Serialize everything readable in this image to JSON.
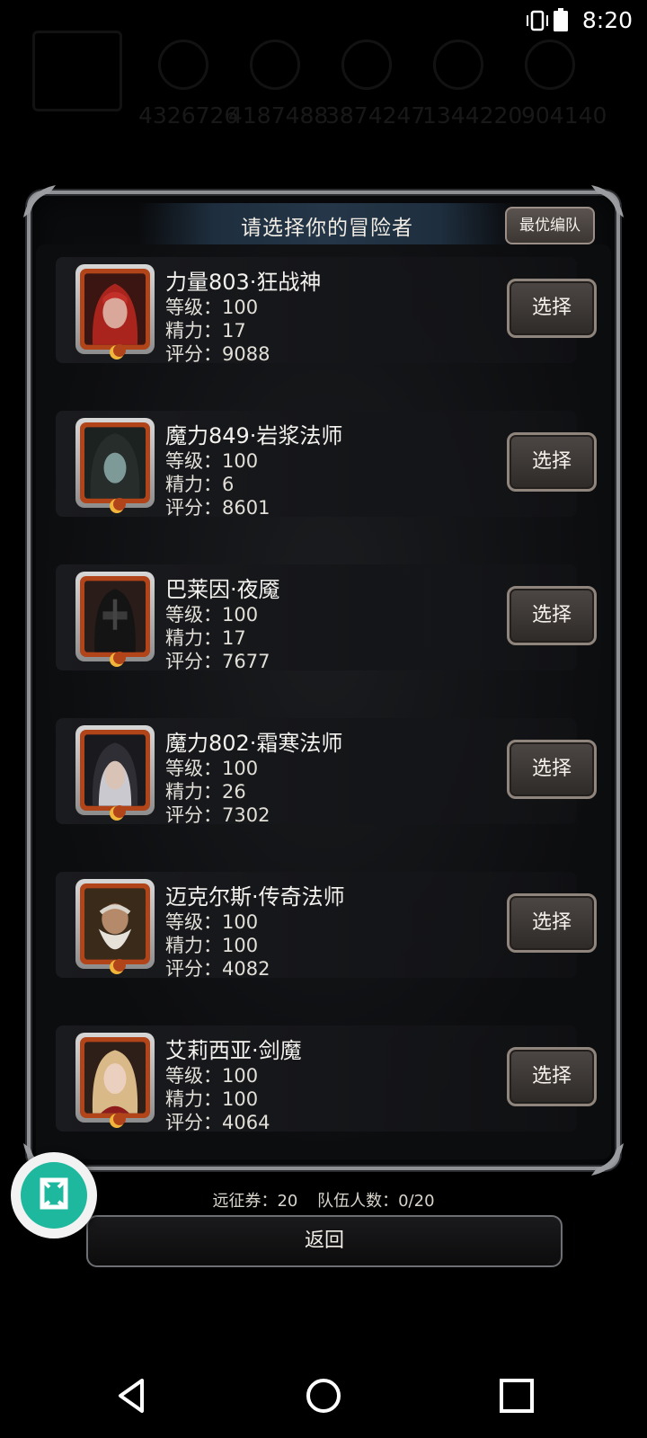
{
  "status_bar": {
    "time": "8:20",
    "icons": [
      "vibrate-icon",
      "battery-icon"
    ]
  },
  "background_hud": {
    "values": [
      "4326726",
      "4187488",
      "3874247",
      "1344220",
      "904140"
    ]
  },
  "dialog": {
    "title": "请选择你的冒险者",
    "best_team_label": "最优编队",
    "select_label": "选择",
    "heroes": [
      {
        "name": "力量803·狂战神",
        "level": "等级：100",
        "energy": "精力：17",
        "score": "评分：9088",
        "portrait": "red-haired-warrior-portrait"
      },
      {
        "name": "魔力849·岩浆法师",
        "level": "等级：100",
        "energy": "精力：6",
        "score": "评分：8601",
        "portrait": "hooded-mage-portrait"
      },
      {
        "name": "巴莱因·夜魇",
        "level": "等级：100",
        "energy": "精力：17",
        "score": "评分：7677",
        "portrait": "masked-assassin-portrait"
      },
      {
        "name": "魔力802·霜寒法师",
        "level": "等级：100",
        "energy": "精力：26",
        "score": "评分：7302",
        "portrait": "frost-mage-portrait"
      },
      {
        "name": "迈克尔斯·传奇法师",
        "level": "等级：100",
        "energy": "精力：100",
        "score": "评分：4082",
        "portrait": "old-wizard-portrait"
      },
      {
        "name": "艾莉西亚·剑魔",
        "level": "等级：100",
        "energy": "精力：100",
        "score": "评分：4064",
        "portrait": "blonde-swordswoman-portrait"
      }
    ]
  },
  "footer": {
    "tickets": "远征券：20",
    "party_count": "队伍人数：0/20",
    "back_label": "返回"
  },
  "colors": {
    "frame_orange": "#b2441a",
    "button_border": "#8f857c",
    "float_accent": "#1eb89e"
  },
  "nav_bar": {
    "icons": [
      "back-triangle-icon",
      "home-circle-icon",
      "recents-square-icon"
    ]
  }
}
